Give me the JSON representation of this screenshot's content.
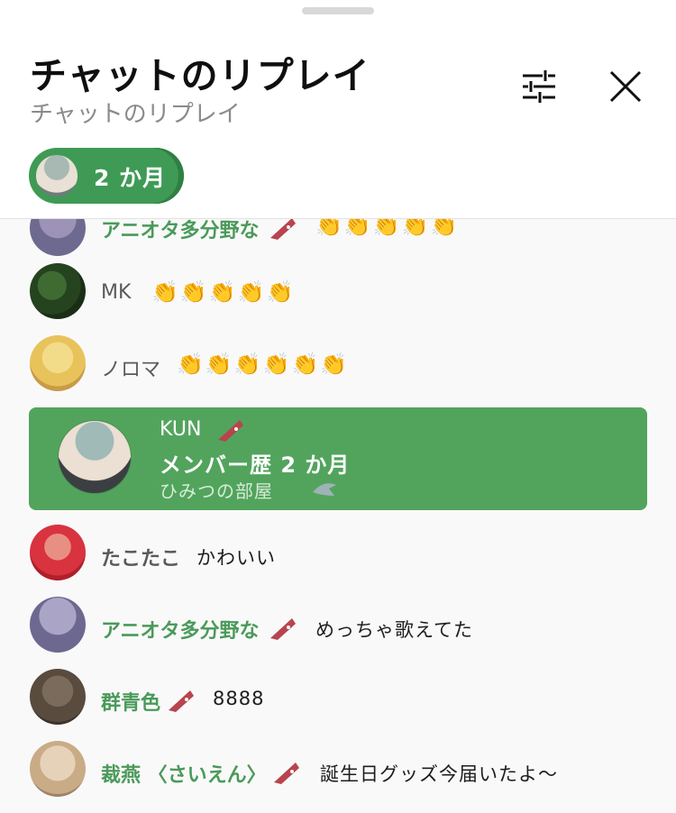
{
  "header": {
    "title": "チャットのリプレイ",
    "subtitle": "チャットのリプレイ",
    "filter_icon": "tune-icon",
    "close_icon": "close-icon"
  },
  "chip": {
    "label": "2 か月",
    "color": "#3f9a55"
  },
  "messages": [
    {
      "author": "アニオタ多分野な",
      "author_color": "#4a9a5a",
      "text": "👏👏👏👏👏",
      "member_badge": true
    },
    {
      "author": "MK",
      "author_color": "#5a5a5a",
      "text": "👏👏👏👏👏",
      "member_badge": false
    },
    {
      "author": "ノロマ",
      "author_color": "#5a5a5a",
      "text": "👏👏👏👏👏👏",
      "member_badge": false
    },
    {
      "author": "たこたこ",
      "author_color": "#5a5a5a",
      "text": "かわいい",
      "member_badge": false
    },
    {
      "author": "アニオタ多分野な",
      "author_color": "#4a9a5a",
      "text": "めっちゃ歌えてた",
      "member_badge": true
    },
    {
      "author": "群青色",
      "author_color": "#4a9a5a",
      "text": "8888",
      "member_badge": true
    },
    {
      "author": "裁燕 〈さいえん〉",
      "author_color": "#4a9a5a",
      "text": "誕生日グッズ今届いたよ〜",
      "member_badge": true
    }
  ],
  "membership_event": {
    "author": "KUN",
    "title": "メンバー歴 2 か月",
    "subtitle": "ひみつの部屋",
    "background": "#52a45d"
  }
}
